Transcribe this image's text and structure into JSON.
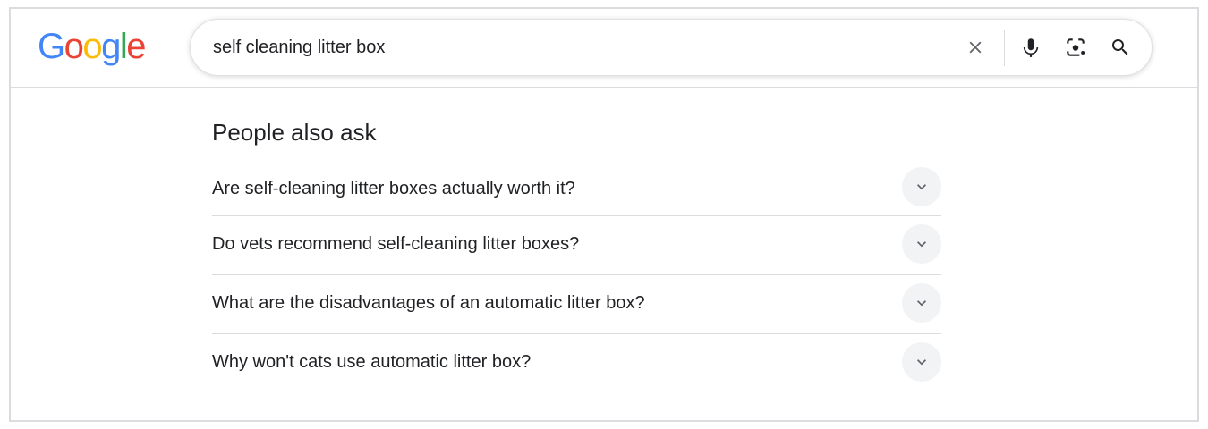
{
  "logo": {
    "letters": [
      "G",
      "o",
      "o",
      "g",
      "l",
      "e"
    ],
    "colors": [
      "#4285F4",
      "#EA4335",
      "#FBBC05",
      "#4285F4",
      "#34A853",
      "#EA4335"
    ]
  },
  "search": {
    "query": "self cleaning litter box",
    "icons": [
      "close-icon",
      "microphone-icon",
      "lens-camera-icon",
      "search-icon"
    ]
  },
  "paa": {
    "title": "People also ask",
    "questions": [
      "Are self-cleaning litter boxes actually worth it?",
      "Do vets recommend self-cleaning litter boxes?",
      "What are the disadvantages of an automatic litter box?",
      "Why won't cats use automatic litter box?"
    ]
  },
  "colors": {
    "text": "#202124",
    "border": "#dadce0",
    "chevron_bg": "#f1f3f4",
    "icon": "#5f6368"
  }
}
